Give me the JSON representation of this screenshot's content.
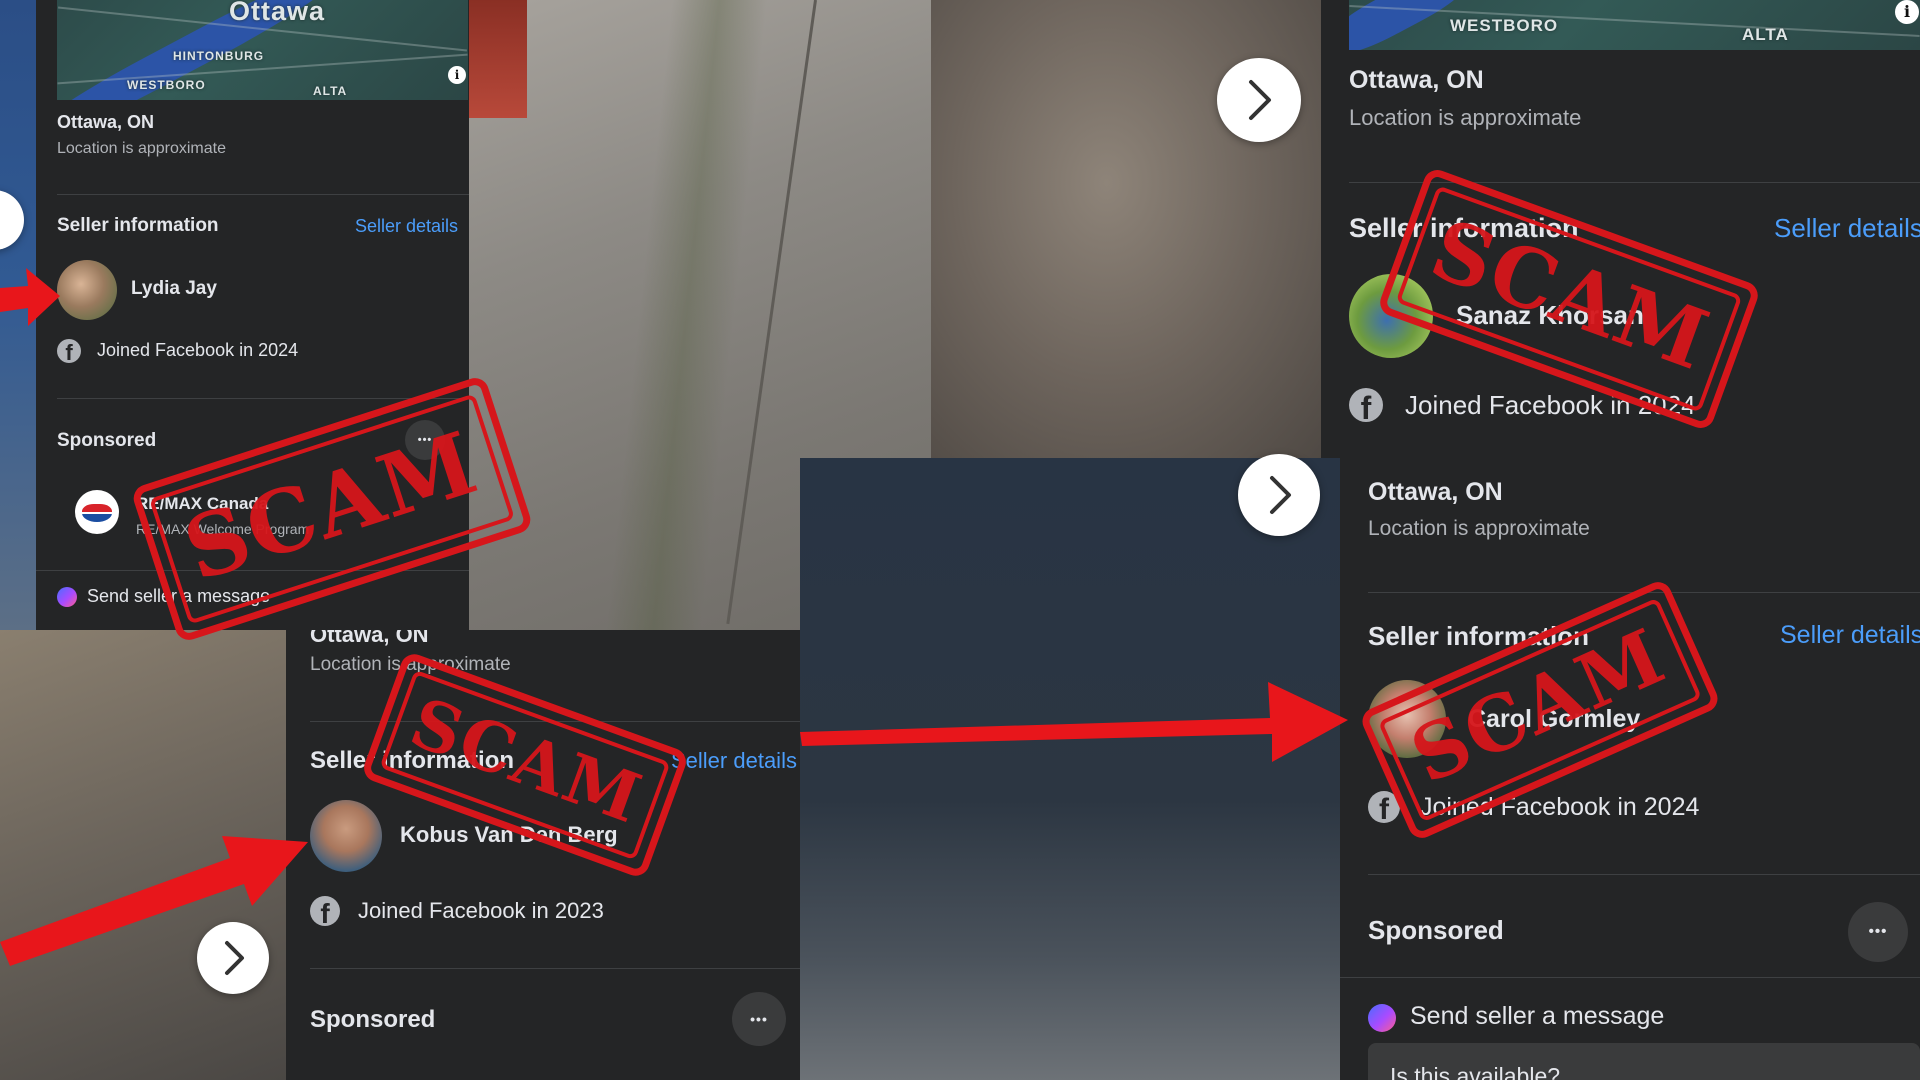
{
  "colors": {
    "accent_link": "#4b9dfa",
    "panel_bg": "#242526",
    "stamp_red": "#d6161b",
    "arrow_red": "#e8161b"
  },
  "stamp_text": "SCAM",
  "panels": {
    "top_left": {
      "map_labels": [
        "Ottawa",
        "HINTONBURG",
        "WESTBORO",
        "ALTA"
      ],
      "info_icon": "i",
      "location": "Ottawa, ON",
      "location_sub": "Location is approximate",
      "seller_info_title": "Seller information",
      "seller_details_link": "Seller details",
      "seller_name": "Lydia Jay",
      "joined": "Joined Facebook in 2024",
      "sponsored_title": "Sponsored",
      "more_label": "•••",
      "ad_name": "RE/MAX Canada",
      "ad_sub": "RE/MAX Welcome Program",
      "send_message": "Send seller a message"
    },
    "top_right": {
      "map_labels": [
        "WESTBORO",
        "ALTA"
      ],
      "info_icon": "i",
      "location": "Ottawa, ON",
      "location_sub": "Location is approximate",
      "seller_info_title": "Seller information",
      "seller_details_link": "Seller details",
      "seller_name": "Sanaz Khorsan",
      "joined": "Joined Facebook in 2024"
    },
    "bottom_left": {
      "location": "Ottawa, ON",
      "location_sub": "Location is approximate",
      "seller_info_title": "Seller information",
      "seller_details_link": "Seller details",
      "seller_name": "Kobus Van Den Berg",
      "joined": "Joined Facebook in 2023",
      "sponsored_title": "Sponsored",
      "more_label": "•••"
    },
    "bottom_right": {
      "location": "Ottawa, ON",
      "location_sub": "Location is approximate",
      "seller_info_title": "Seller information",
      "seller_details_link": "Seller details",
      "seller_name": "Carol Gormley",
      "joined": "Joined Facebook in 2024",
      "sponsored_title": "Sponsored",
      "more_label": "•••",
      "send_message": "Send seller a message",
      "input_value": "Is this available?"
    }
  },
  "fb_glyph": "f",
  "icons": {
    "next": "chevron-right-icon",
    "info": "info-icon",
    "facebook": "facebook-icon",
    "messenger": "messenger-icon",
    "more": "more-options-icon"
  }
}
